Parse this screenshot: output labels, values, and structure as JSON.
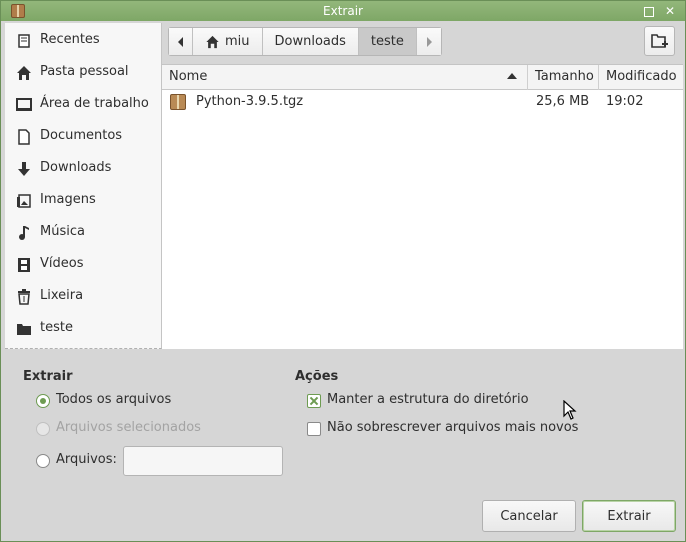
{
  "window": {
    "title": "Extrair"
  },
  "sidebar": {
    "items": [
      {
        "label": "Recentes",
        "icon": "clock-icon"
      },
      {
        "label": "Pasta pessoal",
        "icon": "home-icon"
      },
      {
        "label": "Área de trabalho",
        "icon": "desktop-icon"
      },
      {
        "label": "Documentos",
        "icon": "document-icon"
      },
      {
        "label": "Downloads",
        "icon": "download-icon"
      },
      {
        "label": "Imagens",
        "icon": "image-icon"
      },
      {
        "label": "Música",
        "icon": "music-icon"
      },
      {
        "label": "Vídeos",
        "icon": "video-icon"
      },
      {
        "label": "Lixeira",
        "icon": "trash-icon"
      },
      {
        "label": "teste",
        "icon": "folder-icon"
      }
    ]
  },
  "pathbar": {
    "crumbs": [
      "miu",
      "Downloads",
      "teste"
    ],
    "active": "teste"
  },
  "filelist": {
    "columns": [
      "Nome",
      "Tamanho",
      "Modificado"
    ],
    "rows": [
      {
        "name": "Python-3.9.5.tgz",
        "size": "25,6 MB",
        "modified": "19:02"
      }
    ]
  },
  "extract": {
    "title": "Extrair",
    "all_files": "Todos os arquivos",
    "selected_files": "Arquivos selecionados",
    "files": "Arquivos:",
    "files_value": "",
    "selected_option": "all"
  },
  "actions": {
    "title": "Ações",
    "keep_structure": "Manter a estrutura do diretório",
    "keep_structure_checked": true,
    "no_overwrite": "Não sobrescrever arquivos mais novos",
    "no_overwrite_checked": false
  },
  "buttons": {
    "cancel": "Cancelar",
    "extract": "Extrair"
  },
  "colors": {
    "accent": "#7ea766",
    "titlebar": "#8bb173"
  }
}
